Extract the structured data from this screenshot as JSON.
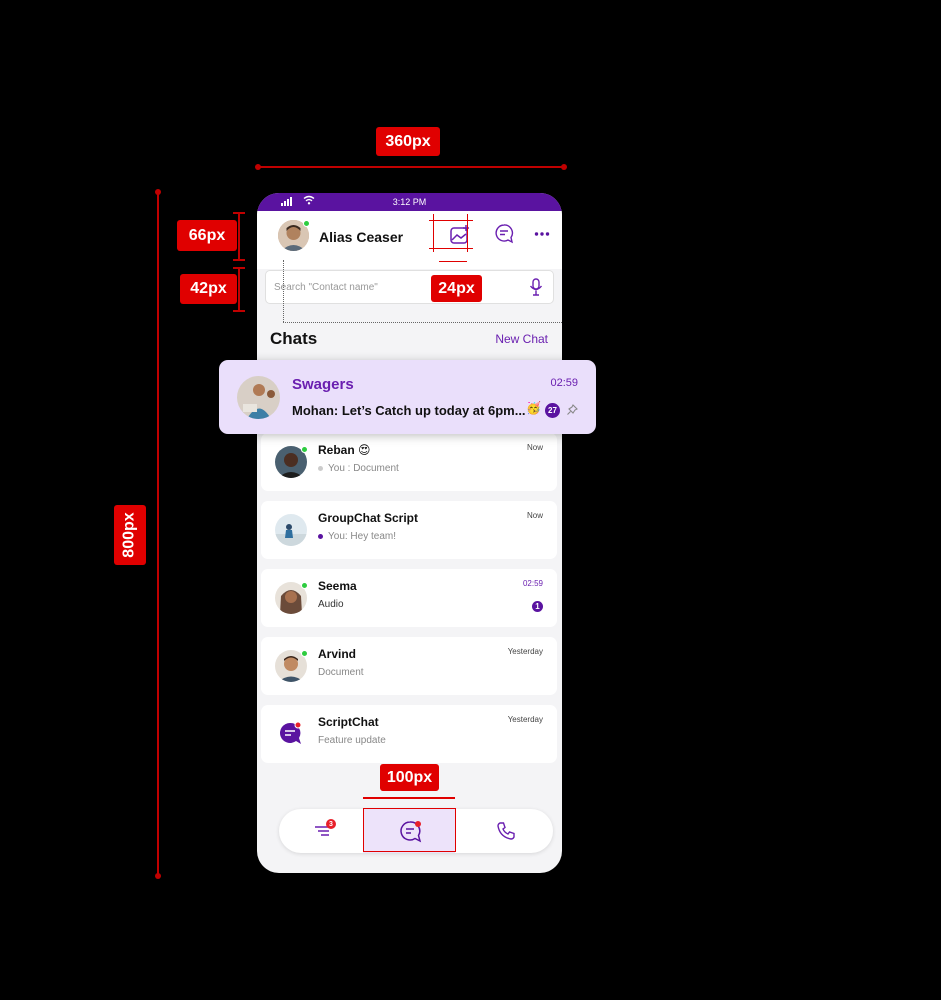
{
  "annotations": {
    "width_label": "360px",
    "height_label": "800px",
    "header_label": "66px",
    "search_label": "42px",
    "icon_label": "24px",
    "nav_label": "100px"
  },
  "status_bar": {
    "time": "3:12 PM"
  },
  "header": {
    "user_name": "Alias Ceaser"
  },
  "search": {
    "placeholder": "Search  \"Contact name\""
  },
  "section": {
    "title": "Chats",
    "action": "New Chat"
  },
  "featured_chat": {
    "name": "Swagers",
    "time": "02:59",
    "message": "Mohan: Let’s Catch up today at 6pm...",
    "emoji": "🥳",
    "unread": "27"
  },
  "chats": [
    {
      "name": "Reban 😍",
      "preview": "You : Document",
      "time": "Now",
      "online": true,
      "bullet": "#cccccc"
    },
    {
      "name": "GroupChat Script",
      "preview": "You: Hey team!",
      "time": "Now",
      "online": false,
      "bullet": "#5a13a0"
    },
    {
      "name": "Seema",
      "preview": "Audio",
      "time": "02:59",
      "online": true,
      "unread": "1"
    },
    {
      "name": "Arvind",
      "preview": "Document",
      "time": "Yesterday",
      "online": true
    },
    {
      "name": "ScriptChat",
      "preview": "Feature update",
      "time": "Yesterday",
      "online": false
    }
  ],
  "bottom_nav": {
    "menu_badge": "3"
  },
  "colors": {
    "accent": "#6a1fb0",
    "status_bar": "#5a13a0",
    "highlight": "#eadffb",
    "annotation": "#e00000"
  }
}
